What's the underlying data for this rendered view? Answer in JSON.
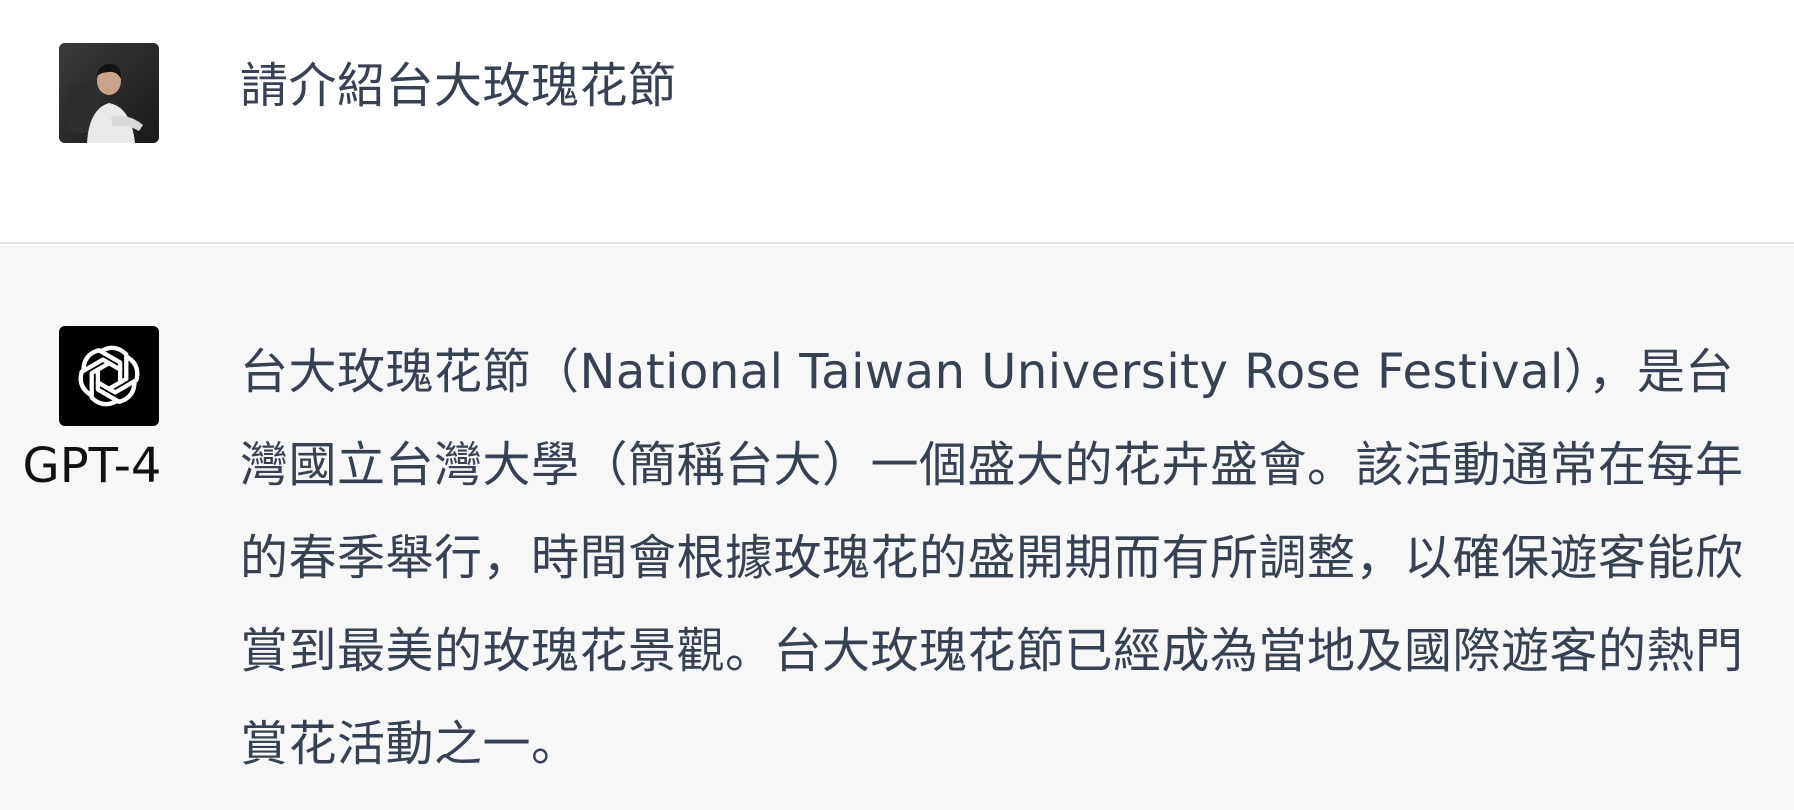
{
  "user_message": {
    "avatar_icon": "user-photo-icon",
    "text": "請介紹台大玫瑰花節"
  },
  "assistant_message": {
    "avatar_icon": "openai-logo-icon",
    "model_label": "GPT-4",
    "text": "台大玫瑰花節（National Taiwan University Rose Festival），是台灣國立台灣大學（簡稱台大）一個盛大的花卉盛會。該活動通常在每年的春季舉行，時間會根據玫瑰花的盛開期而有所調整，以確保遊客能欣賞到最美的玫瑰花景觀。台大玫瑰花節已經成為當地及國際遊客的熱門賞花活動之一。"
  },
  "colors": {
    "assistant_background": "#f7f7f8",
    "text": "#374151",
    "divider": "#e3e3e6"
  }
}
